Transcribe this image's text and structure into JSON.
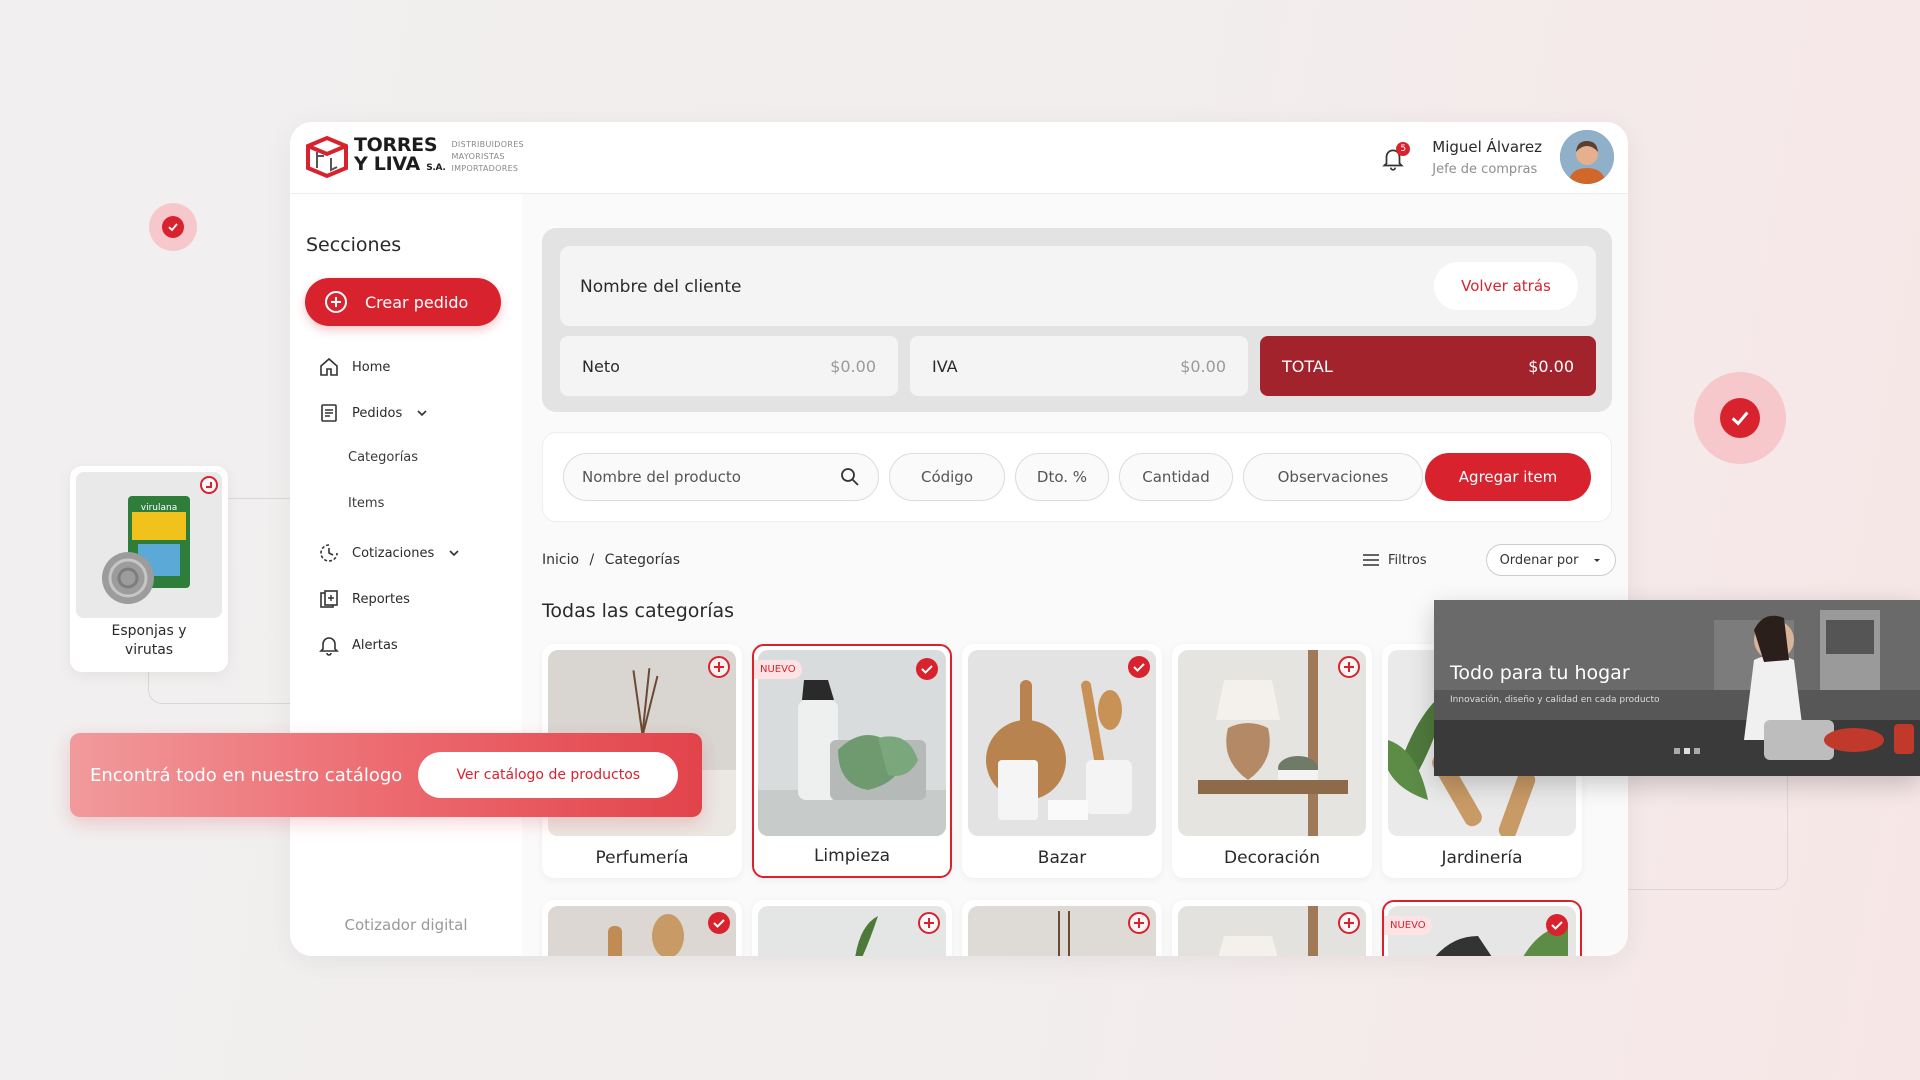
{
  "brand": {
    "name_line1": "TORRES",
    "name_line2": "Y LIVA",
    "name_suffix": "S.A.",
    "tagline": [
      "DISTRIBUIDORES",
      "MAYORISTAS",
      "IMPORTADORES"
    ],
    "accent_color": "#d8232f",
    "dark_accent": "#a3232d"
  },
  "header": {
    "notifications_count": "5",
    "user_name": "Miguel Álvarez",
    "user_role": "Jefe de compras"
  },
  "sidebar": {
    "title": "Secciones",
    "create_label": "Crear pedido",
    "items": [
      {
        "label": "Home",
        "icon": "home-icon"
      },
      {
        "label": "Pedidos",
        "icon": "clipboard-icon"
      },
      {
        "label": "Categorías"
      },
      {
        "label": "Items"
      },
      {
        "label": "Cotizaciones",
        "icon": "quotes-icon"
      },
      {
        "label": "Reportes",
        "icon": "reports-icon"
      },
      {
        "label": "Alertas",
        "icon": "bell-icon"
      }
    ],
    "footer": "Cotizador digital"
  },
  "order": {
    "client_label": "Nombre del cliente",
    "back_label": "Volver atrás",
    "neto_label": "Neto",
    "neto_value": "$0.00",
    "iva_label": "IVA",
    "iva_value": "$0.00",
    "total_label": "TOTAL",
    "total_value": "$0.00"
  },
  "add_item": {
    "product_placeholder": "Nombre del producto",
    "code_placeholder": "Código",
    "discount_placeholder": "Dto. %",
    "quantity_placeholder": "Cantidad",
    "notes_placeholder": "Observaciones",
    "add_label": "Agregar item"
  },
  "listing": {
    "breadcrumb_home": "Inicio",
    "breadcrumb_sep": "/",
    "breadcrumb_current": "Categorías",
    "filters_label": "Filtros",
    "sort_label": "Ordenar por",
    "section_title": "Todas las categorías",
    "new_badge": "NUEVO",
    "categories": [
      {
        "label": "Perfumería",
        "state": "add"
      },
      {
        "label": "Limpieza",
        "state": "selected",
        "badge": "NUEVO"
      },
      {
        "label": "Bazar",
        "state": "check"
      },
      {
        "label": "Decoración",
        "state": "add"
      },
      {
        "label": "Jardinería",
        "state": "add"
      }
    ]
  },
  "promo": {
    "product_label": "Esponjas y virutas",
    "product_brand": "virulana",
    "catalog_text": "Encontrá todo en nuestro catálogo",
    "catalog_button": "Ver catálogo de productos",
    "hero_title": "Todo para tu hogar",
    "hero_subtitle": "Innovación, diseño y calidad en cada producto"
  }
}
